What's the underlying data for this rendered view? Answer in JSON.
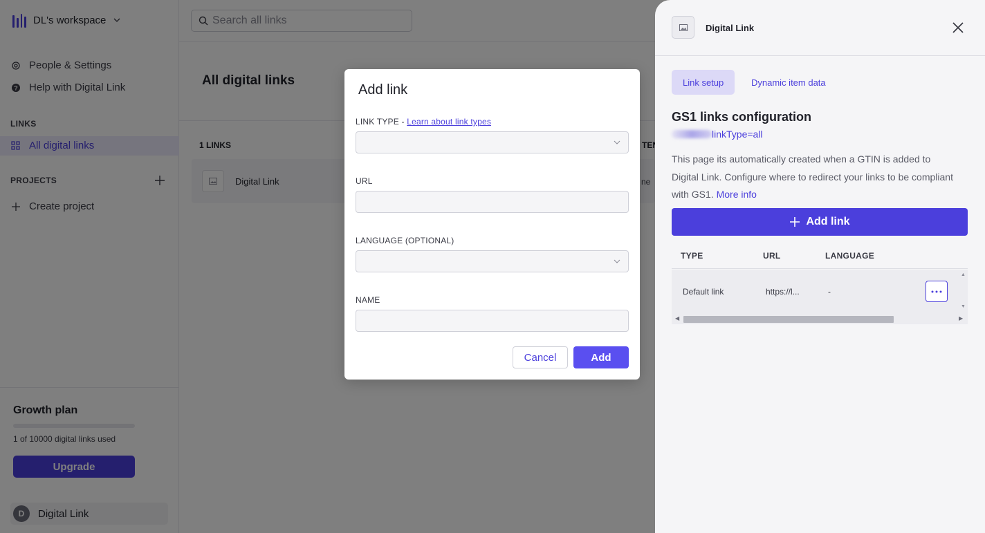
{
  "sidebar": {
    "workspace_name": "DL's workspace",
    "people_settings": "People & Settings",
    "help": "Help with Digital Link",
    "links_section": "LINKS",
    "all_links": "All digital links",
    "projects_section": "PROJECTS",
    "create_project": "Create project",
    "plan": {
      "title": "Growth plan",
      "usage": "1 of 10000 digital links used",
      "usage_fraction": 0.0001,
      "upgrade_label": "Upgrade"
    },
    "user": {
      "initial": "D",
      "name": "Digital Link"
    }
  },
  "search": {
    "placeholder": "Search all links"
  },
  "main": {
    "title": "All digital links",
    "count_label": "1 LINKS",
    "partial_column_header": "TEN",
    "rows": [
      {
        "name": "Digital Link",
        "partial_value": "ne"
      }
    ]
  },
  "panel": {
    "title": "Digital Link",
    "tabs": [
      "Link setup",
      "Dynamic item data"
    ],
    "config_title": "GS1 links configuration",
    "config_sub": "linkType=all",
    "description": "This page its automatically created when a GTIN is added to Digital Link. Configure where to redirect your links to be compliant with GS1.",
    "more_info": "More info",
    "add_link_label": "Add link",
    "table": {
      "headers": [
        "TYPE",
        "URL",
        "LANGUAGE"
      ],
      "rows": [
        {
          "type": "Default link",
          "url": "https://l...",
          "language": "-"
        }
      ]
    }
  },
  "modal": {
    "title": "Add link",
    "link_type_label": "LINK TYPE - ",
    "link_type_help": "Learn about link types",
    "url_label": "URL",
    "language_label": "LANGUAGE (OPTIONAL)",
    "name_label": "NAME",
    "link_type_value": "",
    "url_value": "",
    "language_value": "",
    "name_value": "",
    "cancel_label": "Cancel",
    "add_label": "Add"
  },
  "colors": {
    "accent": "#4b3fdc",
    "accent_light": "#5a4ff0",
    "overlay": "rgba(0,0,0,0.5)"
  }
}
